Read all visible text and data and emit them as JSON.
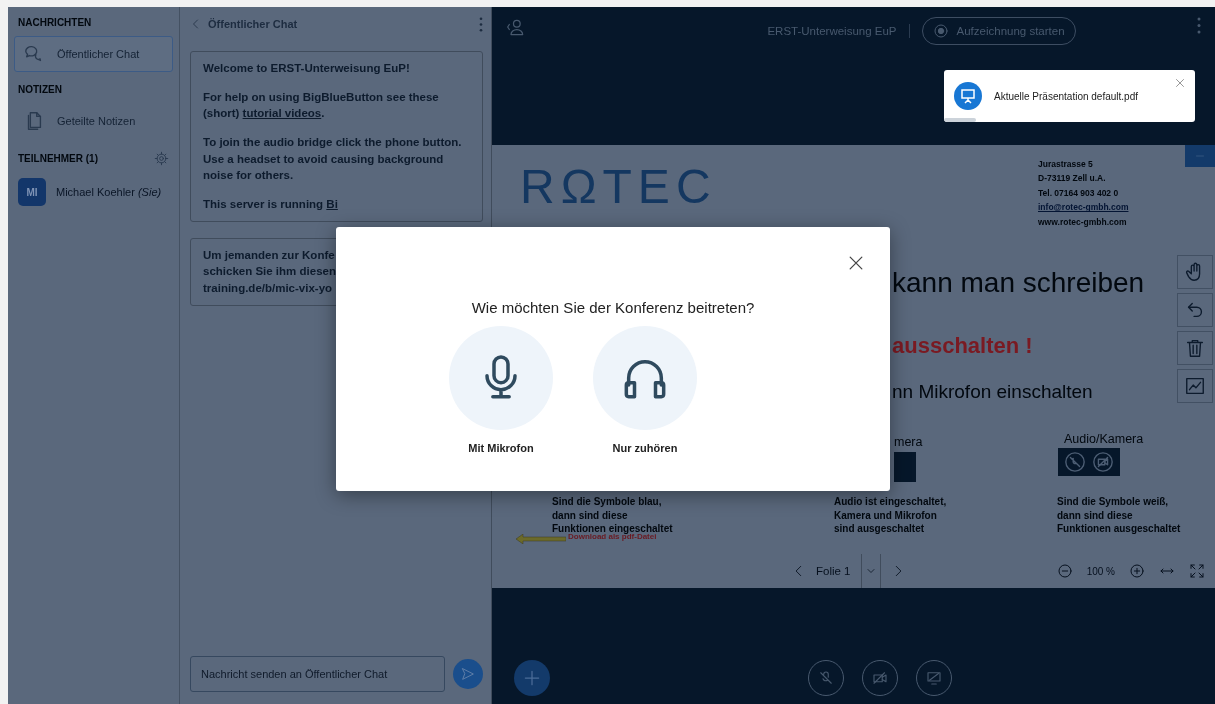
{
  "sidebar": {
    "sections": [
      {
        "title": "NACHRICHTEN",
        "items": [
          {
            "kind": "chat",
            "label": "Öffentlicher Chat",
            "selected": true
          }
        ]
      },
      {
        "title": "NOTIZEN",
        "items": [
          {
            "kind": "notes",
            "label": "Geteilte Notizen",
            "selected": false
          }
        ]
      }
    ],
    "participants": {
      "title": "TEILNEHMER (1)",
      "users": [
        {
          "initials": "MI",
          "name": "Michael Koehler",
          "suffix": "(Sie)"
        }
      ]
    }
  },
  "chat": {
    "title": "Öffentlicher Chat",
    "messages": [
      {
        "paragraphs": [
          {
            "text": "Welcome to ERST-Unterweisung EuP!"
          },
          {
            "text": "For help on using BigBlueButton see these (short) ",
            "link": "tutorial videos",
            "after": "."
          },
          {
            "text": "To join the audio bridge click the phone button. Use a headset to avoid causing background noise for others."
          },
          {
            "text": "This server is running ",
            "link": "Bi"
          }
        ]
      },
      {
        "lines": [
          "Um jemanden zur Konfe",
          "schicken Sie ihm diesen",
          "training.de/b/mic-vix-yo"
        ]
      }
    ],
    "input": {
      "placeholder": "Nachricht senden an Öffentlicher Chat"
    }
  },
  "topbar": {
    "title": "ERST-Unterweisung EuP",
    "record": "Aufzeichnung starten"
  },
  "toast": {
    "text": "Aktuelle Präsentation default.pdf"
  },
  "slide": {
    "logo": "RΩTEC",
    "address": [
      "Jurastrasse 5",
      "D-73119 Zell u.A.",
      "Tel. 07164 903 402 0",
      "info@rotec-gmbh.com",
      "www.rotec-gmbh.com"
    ],
    "heading": "kann man schreiben",
    "warning": "ausschalten !",
    "subheading": "nn Mikrofon einschalten",
    "col_2_label": "mera",
    "col_3_label": "Audio/Kamera",
    "captions": [
      "Sind die Symbole blau,\ndann sind diese\nFunktionen eingeschaltet",
      "Audio ist eingeschaltet,\nKamera und Mikrofon\nsind ausgeschaltet",
      "Sind die Symbole weiß,\ndann sind diese\nFunktionen ausgeschaltet"
    ],
    "download": "Download als pdf-Datei"
  },
  "slide_nav": {
    "slide": "Folie 1",
    "zoom": "100 %"
  },
  "modal": {
    "title": "Wie möchten Sie der Konferenz beitreten?",
    "options": [
      {
        "kind": "microphone",
        "label": "Mit Mikrofon"
      },
      {
        "kind": "listen",
        "label": "Nur zuhören"
      }
    ]
  }
}
